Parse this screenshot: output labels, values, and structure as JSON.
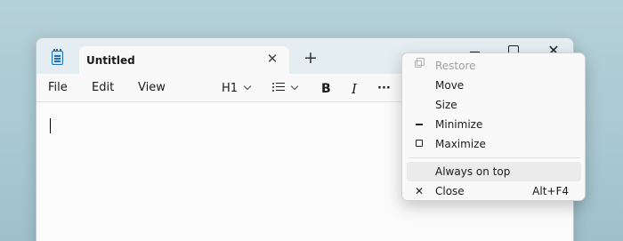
{
  "tab": {
    "title": "Untitled",
    "close_glyph": "✕"
  },
  "new_tab_glyph": "+",
  "caption": {
    "close_glyph": "✕"
  },
  "menu": {
    "file": "File",
    "edit": "Edit",
    "view": "View"
  },
  "toolbar": {
    "heading": "H1",
    "bold": "B",
    "italic": "I",
    "more": "···"
  },
  "context_menu": {
    "items": [
      {
        "label": "Restore",
        "icon": "restore-icon",
        "disabled": true
      },
      {
        "label": "Move",
        "icon": ""
      },
      {
        "label": "Size",
        "icon": ""
      },
      {
        "label": "Minimize",
        "icon": "minimize-icon"
      },
      {
        "label": "Maximize",
        "icon": "maximize-icon"
      },
      {
        "label": "Always on top",
        "icon": ""
      },
      {
        "label": "Close",
        "icon": "close-icon",
        "glyph": "✕",
        "accelerator": "Alt+F4"
      }
    ]
  },
  "colors": {
    "accent": "#1d6fb8",
    "background": "#a9c8d2"
  }
}
